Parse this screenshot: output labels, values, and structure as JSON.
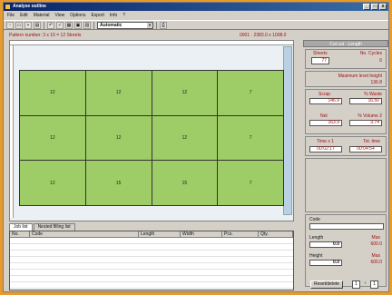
{
  "window": {
    "title": "Analyse outline",
    "controls": [
      "_",
      "□",
      "x"
    ]
  },
  "menu": [
    "File",
    "Edit",
    "Material",
    "View",
    "Options",
    "Export",
    "Info",
    "?"
  ],
  "toolbar": {
    "combo_value": "Automatic"
  },
  "info": {
    "pattern": "Pattern number: 3 x 16 = 12 Streets",
    "size": "0001 · 2383.0 x 1008.0"
  },
  "grid": {
    "rows": [
      [
        "12",
        "12",
        "12",
        "7"
      ],
      [
        "12",
        "12",
        "12",
        "7"
      ],
      [
        "12",
        "15",
        "15",
        "7"
      ]
    ]
  },
  "right_panel": {
    "title": "Cut cut · Length",
    "sheets_label": "Sheets",
    "sheets_value": "77",
    "no_cycles_label": "No. Cycles",
    "no_cycles_value": "6",
    "max_height_label": "Maximum level height",
    "max_height_value": "136.8",
    "scrap_label": "Scrap",
    "scrap_value": "146.9",
    "waste_pct_label": "% Waste",
    "waste_pct_value": "16.50",
    "net_label": "Net",
    "net_value": "163.9",
    "volume_label": "% Volume 2",
    "volume_value": "3.74",
    "time_label": "Time x 1",
    "time_value": "00:02:17",
    "tot_time_label": "Tot. time",
    "tot_time_value": "00:04:54",
    "code_label": "Code",
    "code_value": "",
    "length_label": "Length",
    "length_value": "0.0",
    "length_max_label": "Max",
    "length_max_value": "600.0",
    "height_label": "Height",
    "height_value": "0.0",
    "height_max_label": "Max",
    "height_max_value": "600.0",
    "reset_label": "Reset/delete",
    "spin1": "1",
    "spin2": "1"
  },
  "tabs": [
    "Job list",
    "Nested filling list"
  ],
  "table": {
    "columns": [
      "No.",
      "Code",
      "Length",
      "Width",
      "Pcs.",
      "Qty."
    ]
  },
  "colors": {
    "panel_fill": "#9ecc66",
    "accent_red": "#a01010",
    "title_blue": "#0a246a",
    "desktop": "#e89a2c"
  }
}
